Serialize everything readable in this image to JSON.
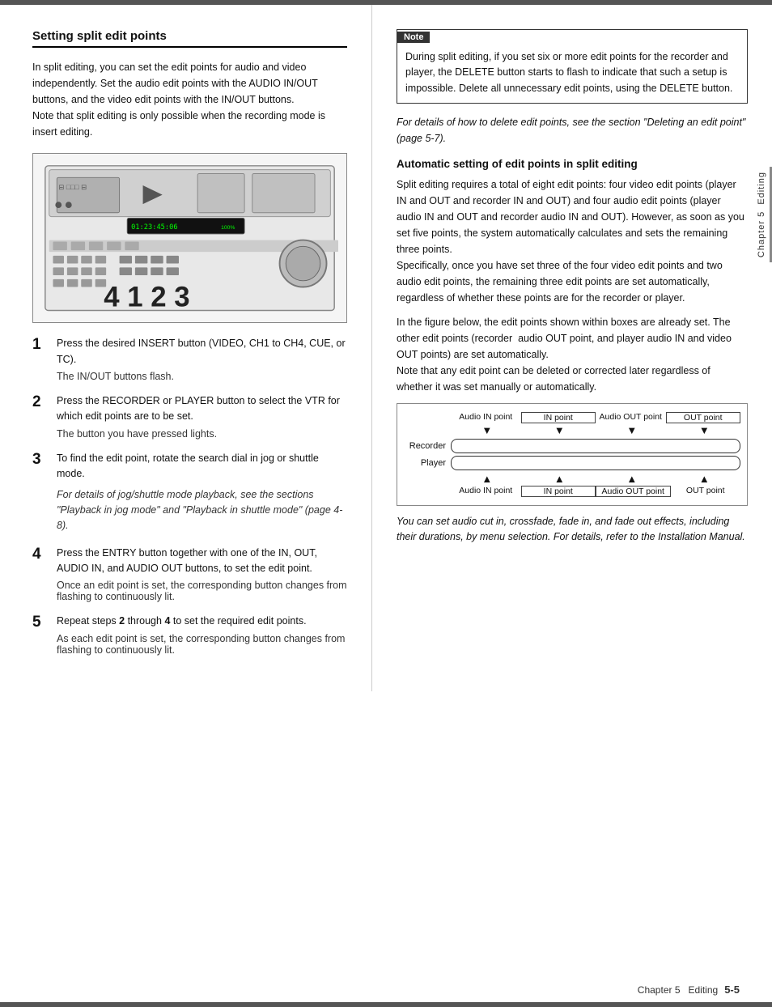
{
  "page": {
    "top_bar": true,
    "bottom_bar": true,
    "left_column": {
      "section_title": "Setting split edit points",
      "intro_text": "In split editing, you can set the edit points for audio and video independently. Set the audio edit points with the AUDIO IN/OUT buttons, and the video edit points with the IN/OUT buttons.\nNote that split editing is only possible when the recording mode is insert editing.",
      "device_labels": [
        "4",
        "1",
        "2",
        "3"
      ],
      "steps": [
        {
          "number": "1",
          "main": "Press the desired INSERT button (VIDEO, CH1 to CH4, CUE, or TC).",
          "note": "The IN/OUT buttons flash."
        },
        {
          "number": "2",
          "main": "Press the RECORDER or PLAYER button to select the VTR for which edit points are to be set.",
          "note": "The button you have pressed lights."
        },
        {
          "number": "3",
          "main": "To find the edit point, rotate the search dial in jog or shuttle mode.",
          "italic": "For details of jog/shuttle mode playback, see the sections \"Playback in jog mode\" and \"Playback in shuttle mode\" (page 4-8)."
        },
        {
          "number": "4",
          "main": "Press the ENTRY button together with one of the IN, OUT, AUDIO IN, and AUDIO OUT buttons, to set the edit point.",
          "note": "Once an edit point is set, the corresponding button changes from flashing to continuously lit."
        },
        {
          "number": "5",
          "main": "Repeat steps 2 through 4 to set the required edit points.",
          "note": "As each edit point is set, the corresponding button changes from flashing to continuously lit."
        }
      ]
    },
    "right_column": {
      "note_box": {
        "label": "Note",
        "content": "During split editing, if you set six or more edit points for the recorder and player, the DELETE button starts to flash to indicate that such a setup is impossible. Delete all unnecessary edit points, using the DELETE button."
      },
      "italic_ref": "For details of how to delete edit points, see the section \"Deleting an edit point\" (page 5-7).",
      "subsection_title": "Automatic setting of edit points in split editing",
      "subsection_body": "Split editing requires a total of eight edit points: four video edit points (player IN and OUT and recorder IN and OUT) and four audio edit points (player audio IN and OUT and recorder audio IN and OUT). However, as soon as you set five points, the system automatically calculates and sets the remaining three points.\nSpecifically, once you have set three of the four video edit points and two audio edit points, the remaining three edit points are set automatically, regardless of whether these points are for the recorder or player.",
      "subsection_body2": "In the figure below, the edit points shown within boxes are already set. The other edit points (recorder  audio OUT point, and player audio IN and video OUT points) are set automatically.\nNote that any edit point can be deleted or corrected later regardless of whether it was set manually or automatically.",
      "diagram": {
        "top_labels": [
          "Audio IN point",
          "IN point",
          "Audio OUT point",
          "OUT point"
        ],
        "recorder_label": "Recorder",
        "player_label": "Player",
        "bottom_labels": [
          "Audio IN point",
          "IN point",
          "Audio OUT point",
          "OUT point"
        ],
        "boxed_labels_top": [
          "IN point",
          "Audio OUT point"
        ],
        "boxed_labels_bottom": [
          "IN point",
          "Audio OUT point"
        ]
      },
      "diagram_caption": "You can set audio cut in, crossfade, fade in, and fade out effects, including their durations, by menu selection. For details, refer to the Installation Manual.",
      "chapter_sidebar": "Chapter 5  Editing"
    },
    "footer": {
      "right_text": "Chapter 5   Editing",
      "page_number": "5-5"
    }
  }
}
